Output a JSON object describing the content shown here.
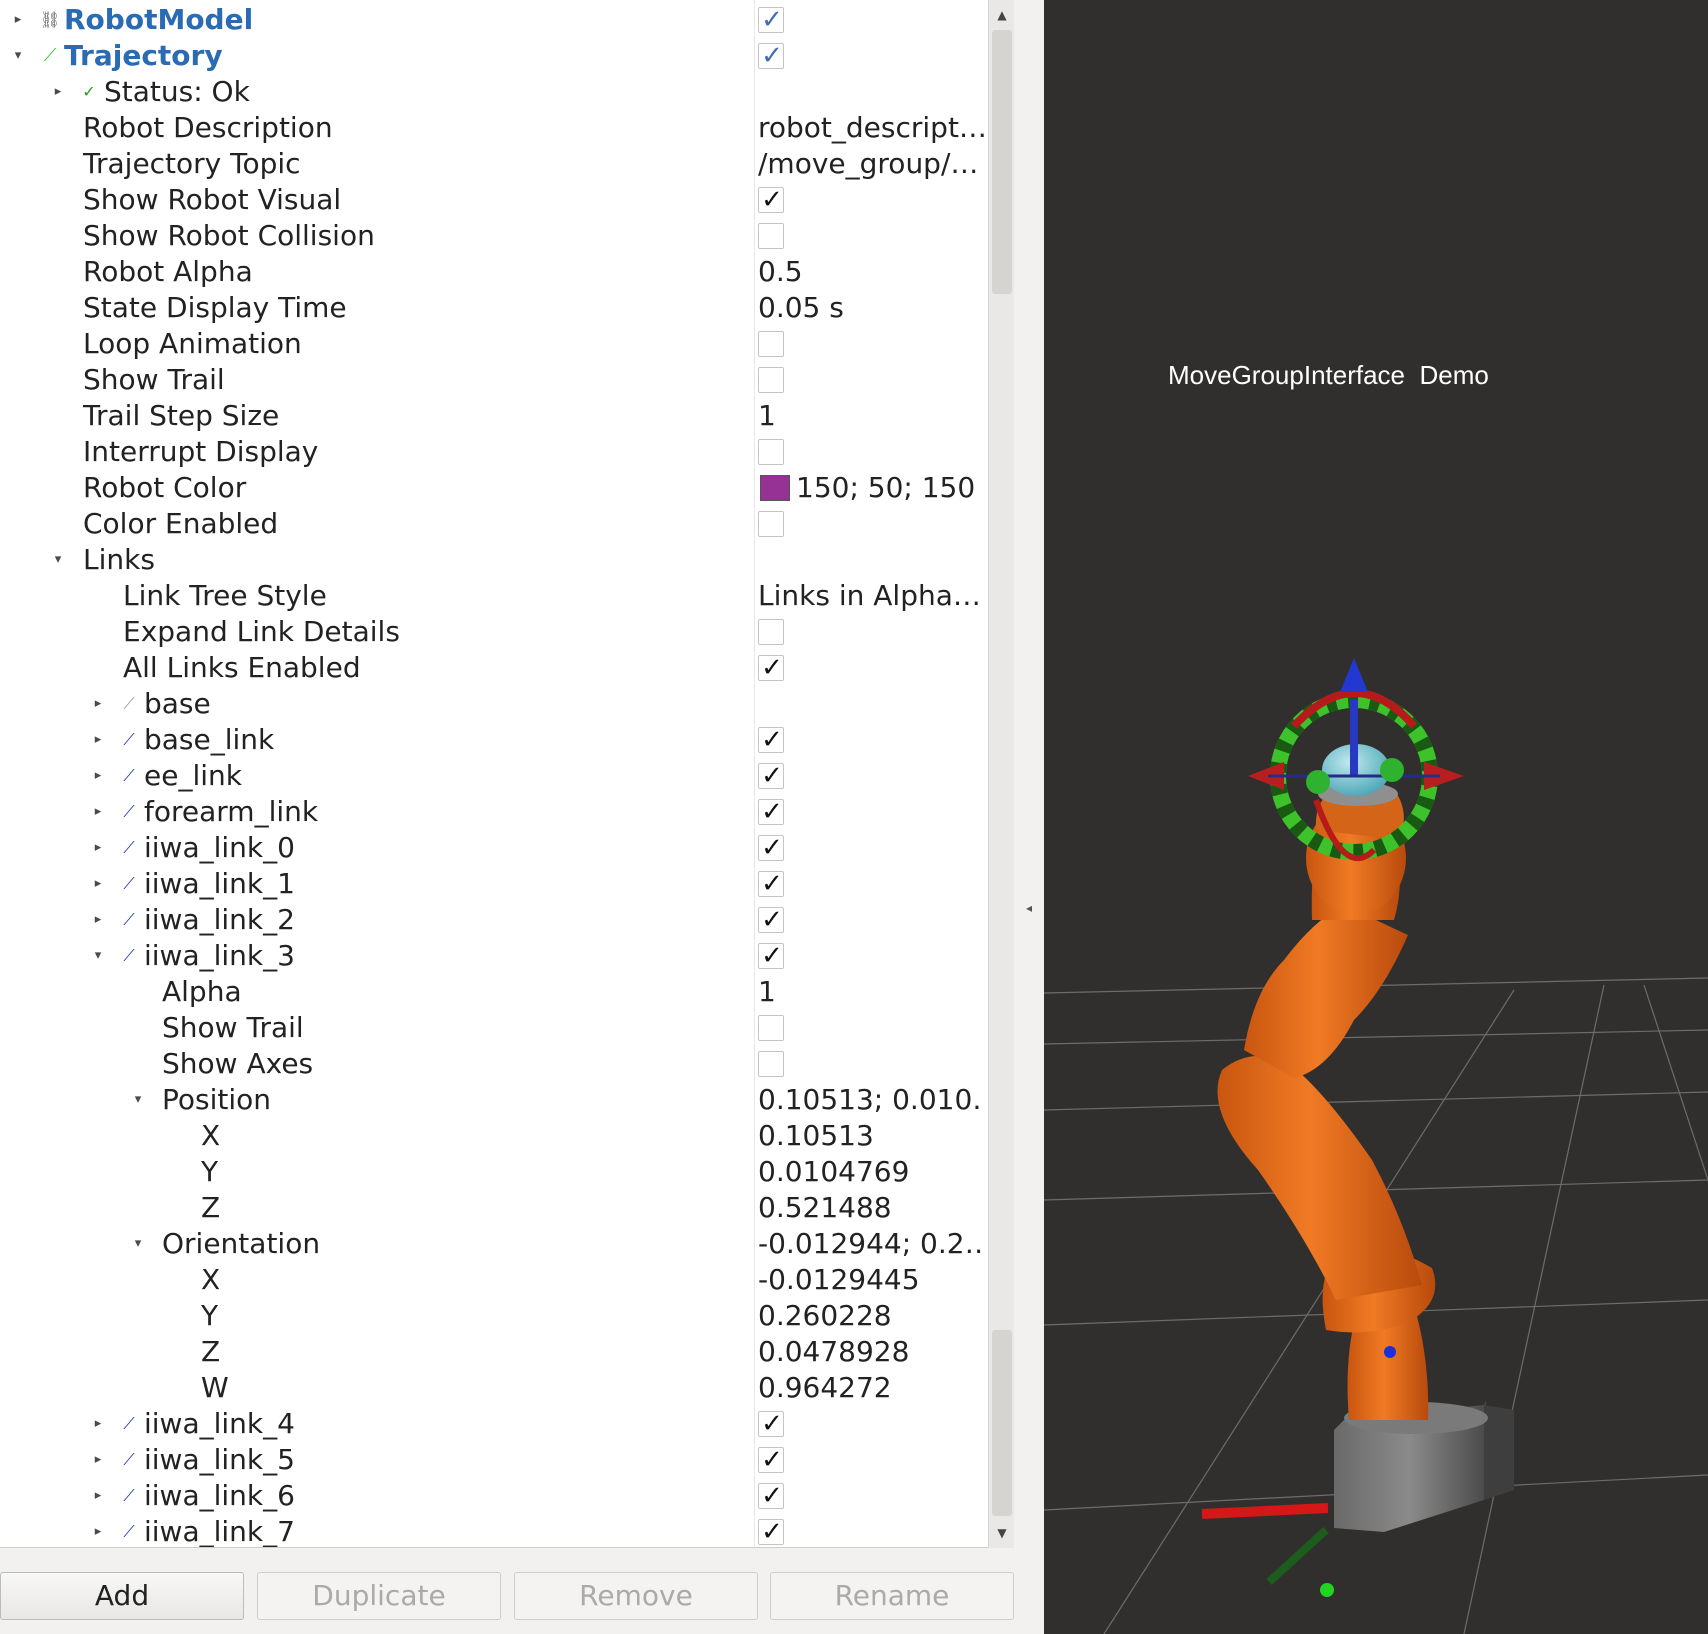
{
  "tree": {
    "robot_model": {
      "label": "RobotModel",
      "icon": "robot-model-icon",
      "checked": true
    },
    "trajectory": {
      "label": "Trajectory",
      "icon": "trajectory-icon",
      "checked": true
    },
    "status": {
      "label": "Status: Ok",
      "icon": "checkmark-icon"
    },
    "properties": {
      "robot_description": {
        "label": "Robot Description",
        "value": "robot_descript…"
      },
      "trajectory_topic": {
        "label": "Trajectory Topic",
        "value": "/move_group/…"
      },
      "show_robot_visual": {
        "label": "Show Robot Visual",
        "checked": true
      },
      "show_robot_collision": {
        "label": "Show Robot Collision",
        "checked": false
      },
      "robot_alpha": {
        "label": "Robot Alpha",
        "value": "0.5"
      },
      "state_display_time": {
        "label": "State Display Time",
        "value": "0.05 s"
      },
      "loop_animation": {
        "label": "Loop Animation",
        "checked": false
      },
      "show_trail": {
        "label": "Show Trail",
        "checked": false
      },
      "trail_step_size": {
        "label": "Trail Step Size",
        "value": "1"
      },
      "interrupt_display": {
        "label": "Interrupt Display",
        "checked": false
      },
      "robot_color": {
        "label": "Robot Color",
        "value": "150; 50; 150",
        "swatch": "#963296"
      },
      "color_enabled": {
        "label": "Color Enabled",
        "checked": false
      }
    },
    "links": {
      "label": "Links",
      "link_tree_style": {
        "label": "Link Tree Style",
        "value": "Links in Alpha…"
      },
      "expand_link_details": {
        "label": "Expand Link Details",
        "checked": false
      },
      "all_links_enabled": {
        "label": "All Links Enabled",
        "checked": true
      },
      "items": [
        {
          "label": "base",
          "checked": null
        },
        {
          "label": "base_link",
          "checked": true
        },
        {
          "label": "ee_link",
          "checked": true
        },
        {
          "label": "forearm_link",
          "checked": true
        },
        {
          "label": "iiwa_link_0",
          "checked": true
        },
        {
          "label": "iiwa_link_1",
          "checked": true
        },
        {
          "label": "iiwa_link_2",
          "checked": true
        },
        {
          "label": "iiwa_link_3",
          "checked": true
        }
      ],
      "iiwa_link_3_details": {
        "alpha": {
          "label": "Alpha",
          "value": "1"
        },
        "show_trail": {
          "label": "Show Trail",
          "checked": false
        },
        "show_axes": {
          "label": "Show Axes",
          "checked": false
        },
        "position": {
          "label": "Position",
          "value": "0.10513; 0.010…",
          "x": {
            "label": "X",
            "value": "0.10513"
          },
          "y": {
            "label": "Y",
            "value": "0.0104769"
          },
          "z": {
            "label": "Z",
            "value": "0.521488"
          }
        },
        "orientation": {
          "label": "Orientation",
          "value": "-0.012944; 0.2…",
          "x": {
            "label": "X",
            "value": "-0.0129445"
          },
          "y": {
            "label": "Y",
            "value": "0.260228"
          },
          "z": {
            "label": "Z",
            "value": "0.0478928"
          },
          "w": {
            "label": "W",
            "value": "0.964272"
          }
        }
      },
      "more_items": [
        {
          "label": "iiwa_link_4",
          "checked": true
        },
        {
          "label": "iiwa_link_5",
          "checked": true
        },
        {
          "label": "iiwa_link_6",
          "checked": true
        },
        {
          "label": "iiwa_link_7",
          "checked": true
        }
      ]
    }
  },
  "buttons": {
    "add": "Add",
    "duplicate": "Duplicate",
    "remove": "Remove",
    "rename": "Rename"
  },
  "viewport": {
    "scene_text": "MoveGroupInterface  Demo",
    "background_color": "#302f2d",
    "robot_color": "#e06a1c",
    "marker_ring_color": "#3ec22b"
  },
  "colors": {
    "display_name": "#2a6bb3",
    "link_icon": "#1e3aa8",
    "trajectory_icon": "#2ecc2e"
  }
}
